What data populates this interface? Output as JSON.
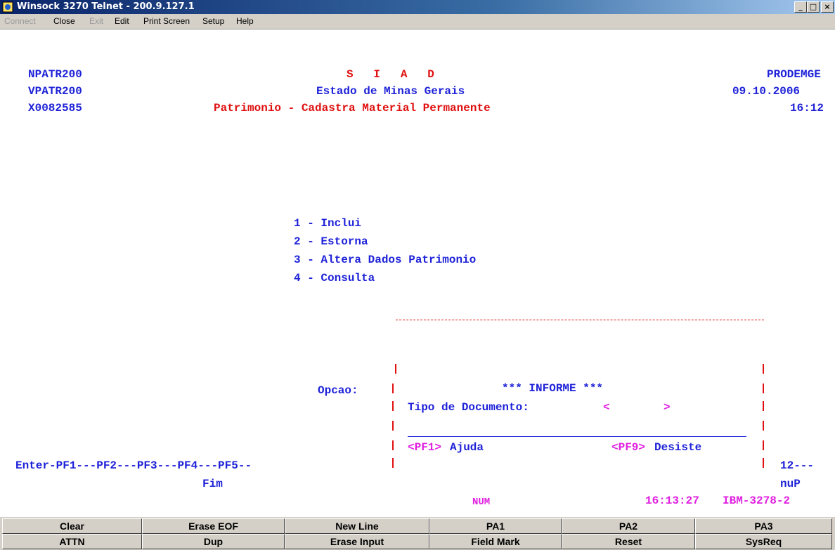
{
  "window": {
    "title": "Winsock 3270 Telnet - 200.9.127.1",
    "controls": {
      "minimize": "_",
      "maximize": "□",
      "close": "×"
    }
  },
  "menubar": {
    "items": [
      {
        "label": "Connect",
        "enabled": false
      },
      {
        "label": "Close",
        "enabled": true
      },
      {
        "label": "Exit",
        "enabled": false
      },
      {
        "label": "Edit",
        "enabled": true
      },
      {
        "label": "Print Screen",
        "enabled": true
      },
      {
        "label": "Setup",
        "enabled": true
      },
      {
        "label": "Help",
        "enabled": true
      }
    ]
  },
  "screen": {
    "header": {
      "left": [
        "NPATR200",
        "VPATR200",
        "X0082585"
      ],
      "center": [
        "S   I   A   D",
        "Estado de Minas Gerais",
        "Patrimonio - Cadastra Material Permanente"
      ],
      "right": [
        "PRODEMGE",
        "09.10.2006",
        "16:12"
      ]
    },
    "menu_options": [
      "1 - Inclui",
      "2 - Estorna",
      "3 - Altera Dados Patrimonio",
      "4 - Consulta"
    ],
    "opcao_label": "Opcao:",
    "popup": {
      "title": "*** INFORME ***",
      "field_label": "Tipo de Documento:",
      "field_open": "<",
      "field_value": "",
      "field_close": ">",
      "pf1": "<PF1>",
      "pf1_label": "Ajuda",
      "pf9": "<PF9>",
      "pf9_label": "Desiste"
    },
    "pf_line": "Enter-PF1---PF2---PF3---PF4---PF5--",
    "pf_right": "12---",
    "pf_fim": "Fim",
    "pf_right2": "nuP",
    "status": {
      "num": "NUM",
      "time": "16:13:27",
      "model": "IBM-3278-2"
    }
  },
  "keypad": {
    "row1": [
      "Clear",
      "Erase EOF",
      "New Line",
      "PA1",
      "PA2",
      "PA3"
    ],
    "row2": [
      "ATTN",
      "Dup",
      "Erase Input",
      "Field Mark",
      "Reset",
      "SysReq"
    ]
  },
  "colors": {
    "blue": "#1e22d8",
    "red": "#e01010",
    "magenta": "#e020e0",
    "titlebar": "#0a246a"
  }
}
